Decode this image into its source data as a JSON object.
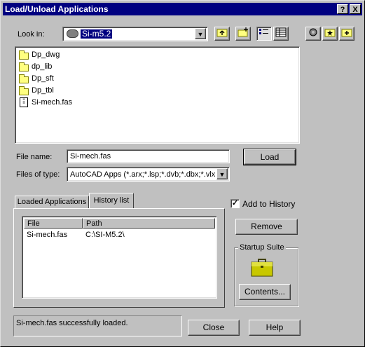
{
  "window": {
    "title": "Load/Unload Applications",
    "help_glyph": "?",
    "close_glyph": "X"
  },
  "look_in": {
    "label": "Look in:",
    "value": "Si-m5.2"
  },
  "file_list": [
    {
      "name": "Dp_dwg",
      "type": "folder"
    },
    {
      "name": "dp_lib",
      "type": "folder"
    },
    {
      "name": "Dp_sft",
      "type": "folder"
    },
    {
      "name": "Dp_tbl",
      "type": "folder"
    },
    {
      "name": "Si-mech.fas",
      "type": "file"
    }
  ],
  "file_name": {
    "label": "File name:",
    "value": "Si-mech.fas"
  },
  "files_of_type": {
    "label": "Files of type:",
    "value": "AutoCAD Apps (*.arx;*.lsp;*.dvb;*.dbx;*.vlx;*."
  },
  "buttons": {
    "load": "Load",
    "remove": "Remove",
    "contents": "Contents...",
    "close": "Close",
    "help": "Help"
  },
  "tabs": [
    {
      "label": "Loaded Applications",
      "active": false
    },
    {
      "label": "History list",
      "active": true
    }
  ],
  "history": {
    "columns": [
      "File",
      "Path"
    ],
    "rows": [
      {
        "file": "Si-mech.fas",
        "path": "C:\\SI-M5.2\\"
      }
    ]
  },
  "add_to_history": {
    "label": "Add to History",
    "checked": true,
    "check_glyph": "✓"
  },
  "startup_suite": {
    "label": "Startup Suite"
  },
  "status": "Si-mech.fas successfully loaded.",
  "colors": {
    "titlebar": "#000080",
    "face": "#c0c0c0",
    "selection": "#000080"
  },
  "icons": [
    "folder-icon",
    "file-icon",
    "up-folder-icon",
    "new-folder-icon",
    "list-view-icon",
    "details-view-icon",
    "briefcase-icon"
  ]
}
